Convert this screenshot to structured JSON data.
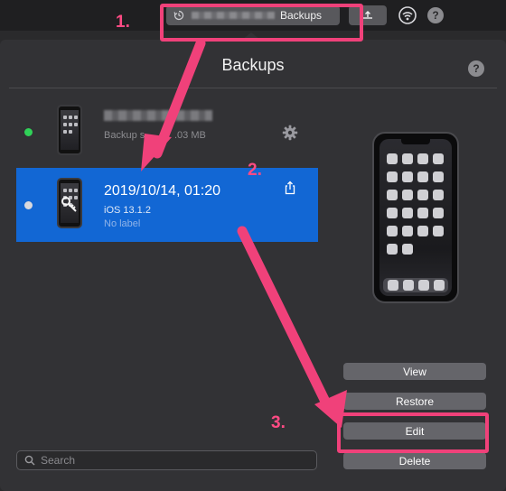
{
  "toolbar": {
    "backups_button_label": "Backups",
    "upload_icon": "upload-arrow-icon",
    "wifi_icon": "wifi-sync-icon",
    "help_label": "?"
  },
  "panel": {
    "title": "Backups",
    "help_label": "?"
  },
  "backups": [
    {
      "status_color": "#30d158",
      "size_text_prefix": "Backup s",
      "size_text_suffix": ".03 MB",
      "settings_icon": "gear-icon",
      "selected": false
    },
    {
      "status_color": "#d9d9dd",
      "date": "2019/10/14, 01:20",
      "ios_version": "iOS 13.1.2",
      "label": "No label",
      "share_icon": "share-icon",
      "selected": true
    }
  ],
  "actions": {
    "view": "View",
    "restore": "Restore",
    "edit": "Edit",
    "delete": "Delete"
  },
  "search": {
    "placeholder": "Search"
  },
  "annotations": {
    "color": "#f0417a",
    "step1": "1.",
    "step2": "2.",
    "step3": "3."
  }
}
